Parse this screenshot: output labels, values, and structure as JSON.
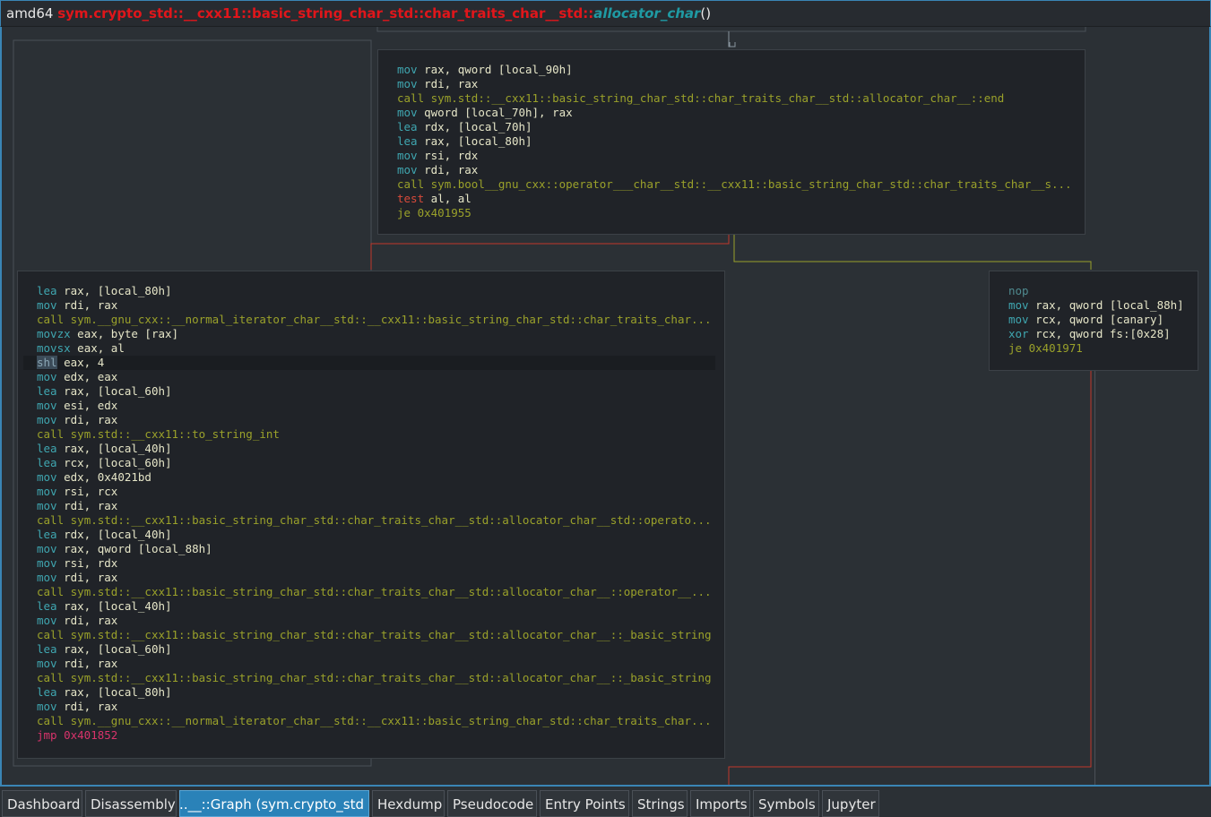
{
  "header": {
    "arch": "amd64",
    "function_prefix": "sym.crypto_std::__cxx11::basic_string_char_std::char_traits_char__std::",
    "function_suffix": "allocator_char",
    "parens": "()"
  },
  "blocks": {
    "top": {
      "lines": [
        {
          "op": "mov",
          "args": "rax, qword [local_90h]"
        },
        {
          "op": "mov",
          "args": "rdi, rax"
        },
        {
          "op": "call",
          "args": "sym.std::__cxx11::basic_string_char_std::char_traits_char__std::allocator_char__::end"
        },
        {
          "op": "mov",
          "args": "qword [local_70h], rax"
        },
        {
          "op": "lea",
          "args": "rdx, [local_70h]"
        },
        {
          "op": "lea",
          "args": "rax, [local_80h]"
        },
        {
          "op": "mov",
          "args": "rsi, rdx"
        },
        {
          "op": "mov",
          "args": "rdi, rax"
        },
        {
          "op": "call",
          "args": "sym.bool__gnu_cxx::operator___char__std::__cxx11::basic_string_char_std::char_traits_char__s..."
        },
        {
          "op": "test",
          "args": "al, al"
        },
        {
          "op": "je",
          "args": "0x401955"
        }
      ]
    },
    "left": {
      "lines": [
        {
          "op": "lea",
          "args": "rax, [local_80h]"
        },
        {
          "op": "mov",
          "args": "rdi, rax"
        },
        {
          "op": "call",
          "args": "sym.__gnu_cxx::__normal_iterator_char__std::__cxx11::basic_string_char_std::char_traits_char..."
        },
        {
          "op": "movzx",
          "args": "eax, byte [rax]"
        },
        {
          "op": "movsx",
          "args": "eax, al"
        },
        {
          "op": "shl",
          "args": "eax, 4"
        },
        {
          "op": "mov",
          "args": "edx, eax"
        },
        {
          "op": "lea",
          "args": "rax, [local_60h]"
        },
        {
          "op": "mov",
          "args": "esi, edx"
        },
        {
          "op": "mov",
          "args": "rdi, rax"
        },
        {
          "op": "call",
          "args": "sym.std::__cxx11::to_string_int"
        },
        {
          "op": "lea",
          "args": "rax, [local_40h]"
        },
        {
          "op": "lea",
          "args": "rcx, [local_60h]"
        },
        {
          "op": "mov",
          "args": "edx, 0x4021bd"
        },
        {
          "op": "mov",
          "args": "rsi, rcx"
        },
        {
          "op": "mov",
          "args": "rdi, rax"
        },
        {
          "op": "call",
          "args": "sym.std::__cxx11::basic_string_char_std::char_traits_char__std::allocator_char__std::operato..."
        },
        {
          "op": "lea",
          "args": "rdx, [local_40h]"
        },
        {
          "op": "mov",
          "args": "rax, qword [local_88h]"
        },
        {
          "op": "mov",
          "args": "rsi, rdx"
        },
        {
          "op": "mov",
          "args": "rdi, rax"
        },
        {
          "op": "call",
          "args": "sym.std::__cxx11::basic_string_char_std::char_traits_char__std::allocator_char__::operator__..."
        },
        {
          "op": "lea",
          "args": "rax, [local_40h]"
        },
        {
          "op": "mov",
          "args": "rdi, rax"
        },
        {
          "op": "call",
          "args": "sym.std::__cxx11::basic_string_char_std::char_traits_char__std::allocator_char__::_basic_string"
        },
        {
          "op": "lea",
          "args": "rax, [local_60h]"
        },
        {
          "op": "mov",
          "args": "rdi, rax"
        },
        {
          "op": "call",
          "args": "sym.std::__cxx11::basic_string_char_std::char_traits_char__std::allocator_char__::_basic_string"
        },
        {
          "op": "lea",
          "args": "rax, [local_80h]"
        },
        {
          "op": "mov",
          "args": "rdi, rax"
        },
        {
          "op": "call",
          "args": "sym.__gnu_cxx::__normal_iterator_char__std::__cxx11::basic_string_char_std::char_traits_char..."
        },
        {
          "op": "jmp",
          "args": "0x401852"
        }
      ]
    },
    "right": {
      "lines": [
        {
          "op": "nop",
          "args": ""
        },
        {
          "op": "mov",
          "args": "rax, qword [local_88h]"
        },
        {
          "op": "mov",
          "args": "rcx, qword [canary]"
        },
        {
          "op": "xor",
          "args": "rcx, qword fs:[0x28]"
        },
        {
          "op": "je",
          "args": "0x401971"
        }
      ]
    }
  },
  "tabs": [
    {
      "label": "Dashboard"
    },
    {
      "label": "Disassembly"
    },
    {
      "label": "Graph (sym.crypto_std::__..."
    },
    {
      "label": "Hexdump"
    },
    {
      "label": "Pseudocode"
    },
    {
      "label": "Entry Points"
    },
    {
      "label": "Strings"
    },
    {
      "label": "Imports"
    },
    {
      "label": "Symbols"
    },
    {
      "label": "Jupyter"
    }
  ],
  "active_tab": 2,
  "highlighted_line": {
    "block": "left",
    "index": 5
  },
  "colors": {
    "accent": "#3a85b5",
    "edge_true": "#9aa12a",
    "edge_false": "#c0392b",
    "edge_jump": "#8a96a0"
  }
}
